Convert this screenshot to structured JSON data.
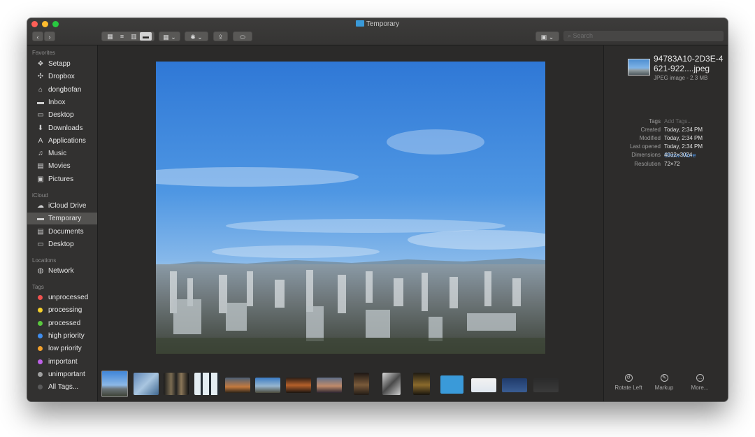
{
  "window": {
    "title": "Temporary"
  },
  "toolbar": {
    "search_placeholder": "Search",
    "view_icons": [
      "▦",
      "≡",
      "▥",
      "▬"
    ],
    "group_icon": "▦ ⌄",
    "action_icon": "✱ ⌄",
    "share_icon": "⇪",
    "tag_icon": "⬭",
    "dropbox_icon": "▣ ⌄"
  },
  "sidebar": {
    "sections": {
      "favorites": "Favorites",
      "icloud": "iCloud",
      "locations": "Locations",
      "tags": "Tags"
    },
    "favorites": [
      {
        "label": "Setapp",
        "icon": "❖"
      },
      {
        "label": "Dropbox",
        "icon": "✣"
      },
      {
        "label": "dongbofan",
        "icon": "⌂"
      },
      {
        "label": "Inbox",
        "icon": "▬"
      },
      {
        "label": "Desktop",
        "icon": "▭"
      },
      {
        "label": "Downloads",
        "icon": "⬇"
      },
      {
        "label": "Applications",
        "icon": "A"
      },
      {
        "label": "Music",
        "icon": "♫"
      },
      {
        "label": "Movies",
        "icon": "▤"
      },
      {
        "label": "Pictures",
        "icon": "▣"
      }
    ],
    "icloud": [
      {
        "label": "iCloud Drive",
        "icon": "☁"
      },
      {
        "label": "Temporary",
        "icon": "▬"
      },
      {
        "label": "Documents",
        "icon": "▤"
      },
      {
        "label": "Desktop",
        "icon": "▭"
      }
    ],
    "locations": [
      {
        "label": "Network",
        "icon": "◍"
      }
    ],
    "tags": [
      {
        "label": "unprocessed",
        "color": "#f0524f"
      },
      {
        "label": "processing",
        "color": "#f5d02b"
      },
      {
        "label": "processed",
        "color": "#5ac83e"
      },
      {
        "label": "high priority",
        "color": "#3f8ef0"
      },
      {
        "label": "low priority",
        "color": "#f3a12c"
      },
      {
        "label": "important",
        "color": "#be61e8"
      },
      {
        "label": "unimportant",
        "color": "#a0a0a0"
      },
      {
        "label": "All Tags...",
        "color": "#5a5a5a"
      }
    ]
  },
  "info": {
    "filename": "94783A10-2D3E-4621-922....jpeg",
    "filetype": "JPEG image - 2.3 MB",
    "meta": [
      {
        "key": "Tags",
        "value": "Add Tags..."
      },
      {
        "key": "Created",
        "value": "Today, 2:34 PM"
      },
      {
        "key": "Modified",
        "value": "Today, 2:34 PM"
      },
      {
        "key": "Last opened",
        "value": "Today, 2:34 PM"
      },
      {
        "key": "Dimensions",
        "value": "4032×3024"
      },
      {
        "key": "Resolution",
        "value": "72×72"
      }
    ],
    "show_more": "Show More",
    "actions": [
      {
        "label": "Rotate Left",
        "icon": "↺"
      },
      {
        "label": "Markup",
        "icon": "✎"
      },
      {
        "label": "More...",
        "icon": "…"
      }
    ]
  }
}
